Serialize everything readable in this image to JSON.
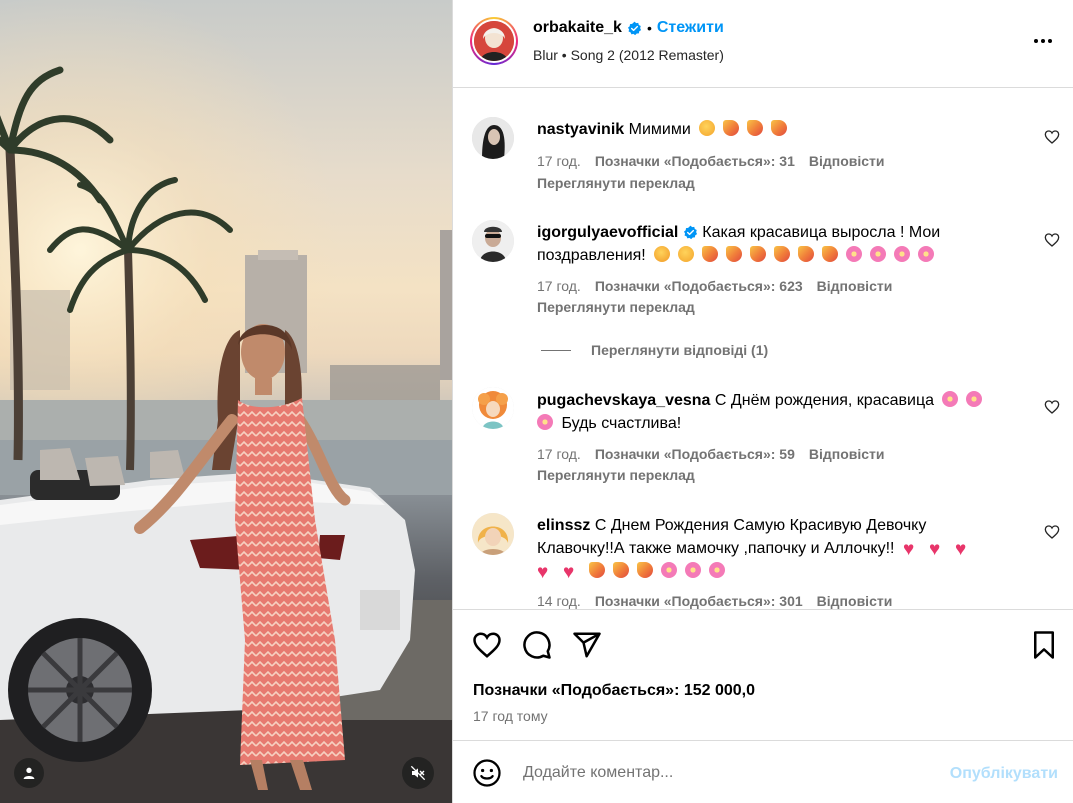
{
  "header": {
    "username": "orbakaite_k",
    "separator": "•",
    "follow_label": "Стежити",
    "audio": "Blur • Song 2 (2012 Remaster)"
  },
  "comments": [
    {
      "username": "nastyavinik",
      "text": "Мимими",
      "emojis": [
        "face",
        "party",
        "party",
        "party"
      ],
      "time": "17 год.",
      "likes": "Позначки «Подобається»: 31",
      "reply": "Відповісти",
      "translate": "Переглянути переклад"
    },
    {
      "username": "igorgulyaevofficial",
      "text_line1": "Какая красавица выросла ! Мои",
      "text_line2": "поздравления!",
      "emojis": [
        "kiss",
        "face",
        "party",
        "party",
        "party",
        "party",
        "party",
        "party",
        "flower",
        "flower",
        "flower",
        "flower"
      ],
      "time": "17 год.",
      "likes": "Позначки «Подобається»: 623",
      "reply": "Відповісти",
      "translate": "Переглянути переклад",
      "view_replies": "Переглянути відповіді (1)"
    },
    {
      "username": "pugachevskaya_vesna",
      "text_line1": "С Днём рождения, красавица",
      "text_line2": "Будь счастлива!",
      "time": "17 год.",
      "likes": "Позначки «Подобається»: 59",
      "reply": "Відповісти",
      "translate": "Переглянути переклад"
    },
    {
      "username": "elinssz",
      "text_line1": "С Днем Рождения Самую Красивую Девочку",
      "text_line2": "Клавочку!!А также мамочку ,папочку и Аллочку!!",
      "time": "14 год.",
      "likes": "Позначки «Подобається»: 301",
      "reply": "Відповісти"
    }
  ],
  "post": {
    "likes": "Позначки «Подобається»: 152 000,0",
    "time": "17 год тому"
  },
  "composer": {
    "placeholder": "Додайте коментар...",
    "publish_label": "Опублікувати"
  },
  "colors": {
    "accent": "#0095f6",
    "muted": "#737373",
    "publish_disabled": "#b2dffc",
    "border": "#dbdbdb"
  },
  "icons": [
    "tag-user-icon",
    "mute-icon",
    "verified-icon",
    "more-icon",
    "heart-icon",
    "comment-icon",
    "share-icon",
    "bookmark-icon",
    "emoji-icon"
  ]
}
